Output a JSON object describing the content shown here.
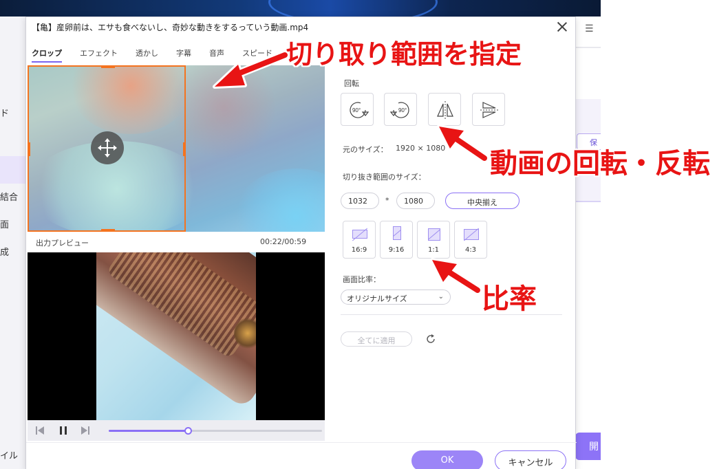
{
  "background": {
    "sidebar_texts": [
      "ド",
      "結合",
      "面",
      "成",
      "イル"
    ],
    "right_menu_icon": "hamburger-icon",
    "right_chip_label": "保",
    "right_open_label": "開"
  },
  "dialog": {
    "title": "【亀】産卵前は、エサも食べないし、奇妙な動きをするっていう動画.mp4",
    "tabs": [
      {
        "label": "クロップ",
        "active": true
      },
      {
        "label": "エフェクト",
        "active": false
      },
      {
        "label": "透かし",
        "active": false
      },
      {
        "label": "字幕",
        "active": false
      },
      {
        "label": "音声",
        "active": false
      },
      {
        "label": "スピード",
        "active": false
      }
    ],
    "preview": {
      "label": "出力プレビュー",
      "time": "00:22/00:59",
      "progress": 0.37
    },
    "settings": {
      "rotation_label": "回転",
      "rotate_left_label": "90°",
      "rotate_right_label": "90°",
      "original_size_label": "元のサイズ：",
      "original_size_value": "1920 × 1080",
      "crop_size_label": "切り抜き範囲のサイズ：",
      "crop_width": "1032",
      "crop_separator": "*",
      "crop_height": "1080",
      "center_button": "中央揃え",
      "ratios": [
        "16:9",
        "9:16",
        "1:1",
        "4:3"
      ],
      "aspect_label": "画面比率：",
      "aspect_value": "オリジナルサイズ",
      "apply_all": "全てに適用"
    },
    "ok": "OK",
    "cancel": "キャンセル"
  },
  "annotations": {
    "crop": "切り取り範囲を指定",
    "rotate": "動画の回転・反転",
    "ratio": "比率",
    "color": "#e81414"
  },
  "colors": {
    "accent": "#8a70f5",
    "crop_border": "#f4731f"
  }
}
